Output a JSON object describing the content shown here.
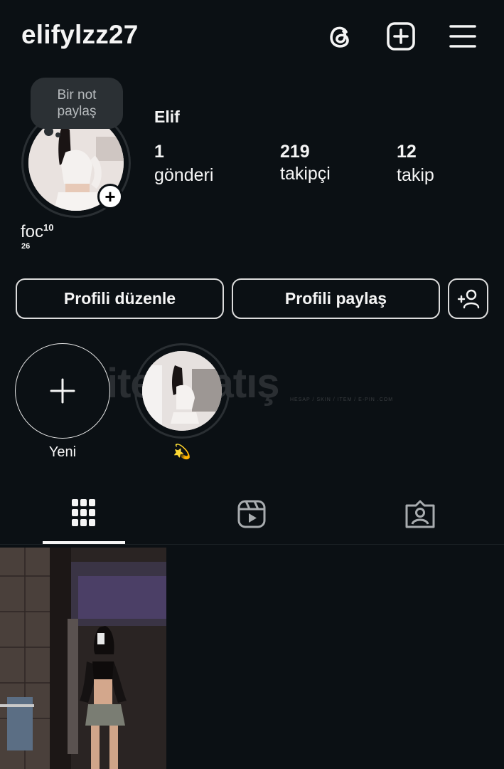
{
  "header": {
    "username": "elifylzz27",
    "icons": [
      "threads-icon",
      "create-post-icon",
      "menu-icon"
    ]
  },
  "note": {
    "text_line1": "Bir not",
    "text_line2": "paylaş"
  },
  "profile": {
    "display_name": "Elif",
    "stats": [
      {
        "value": "1",
        "label": "gönderi"
      },
      {
        "value": "219",
        "label": "takipçi"
      },
      {
        "value": "12",
        "label": "takip"
      }
    ],
    "bio_main": "foc",
    "bio_sup": "10",
    "bio_sub": "26"
  },
  "actions": {
    "edit_label": "Profili düzenle",
    "share_label": "Profili paylaş"
  },
  "highlights": {
    "new_label": "Yeni",
    "items": [
      {
        "label": "💫"
      }
    ]
  },
  "watermark": {
    "text": "itemsatış",
    "small": "HESAP / SKIN / ITEM / E-PIN  .COM"
  },
  "colors": {
    "background": "#0b1014",
    "text": "#f5f5f5",
    "note_bg": "#2b3034"
  }
}
